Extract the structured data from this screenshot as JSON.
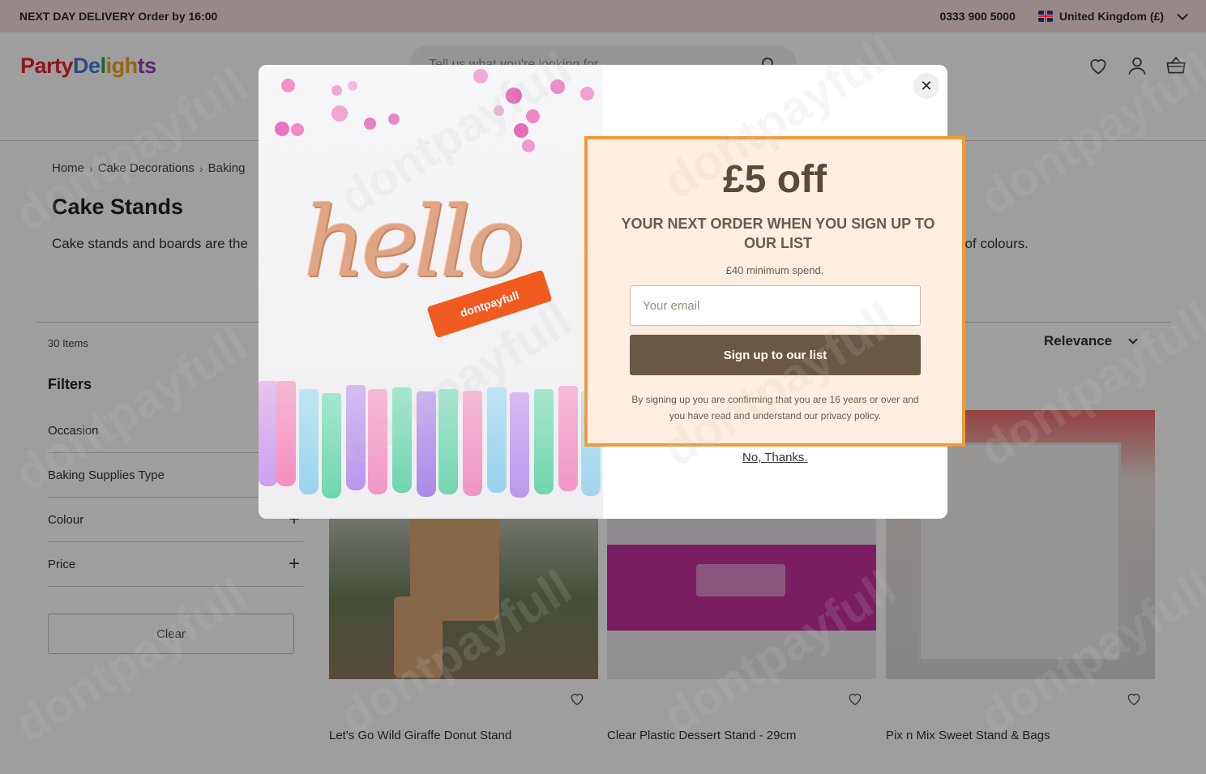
{
  "topbar": {
    "promo": "NEXT DAY DELIVERY Order by 16:00",
    "phone": "0333 900 5000",
    "region": "United Kingdom (£)"
  },
  "header": {
    "logo": {
      "part1": "Party",
      "part2": "De",
      "part3": "l",
      "part4": "igh",
      "part5": "ts"
    },
    "search_placeholder": "Tell us what you're looking for"
  },
  "breadcrumb": [
    "Home",
    "Cake Decorations",
    "Baking"
  ],
  "page": {
    "title": "Cake Stands",
    "description_left": "Cake stands and boards are the",
    "description_right": "ange of colours."
  },
  "listing": {
    "count": "30 Items",
    "sort_label": "Relevance",
    "filters_title": "Filters",
    "filters": [
      "Occasion",
      "Baking Supplies Type",
      "Colour",
      "Price"
    ],
    "clear_label": "Clear"
  },
  "products": [
    {
      "name": "Let's Go Wild Giraffe Donut Stand"
    },
    {
      "name": "Clear Plastic Dessert Stand - 29cm"
    },
    {
      "name": "Pix n Mix Sweet Stand & Bags"
    }
  ],
  "modal": {
    "image_text": "hello",
    "tag_text": "dontpayfull",
    "offer_title": "£5 off",
    "offer_subtitle": "YOUR NEXT ORDER WHEN YOU SIGN UP TO OUR LIST",
    "min_spend": "£40 minimum spend.",
    "email_placeholder": "Your email",
    "signup_label": "Sign up to our list",
    "legal_text": "By signing up you are confirming that you are 16 years or over and you have read and understand our privacy policy.",
    "no_thanks": "No, Thanks.",
    "close_symbol": "✕"
  },
  "watermark": "dontpayfull",
  "colors": {
    "topbar_bg": "#f5dede",
    "offer_border": "#f19a39",
    "offer_bg": "#fdeee1",
    "signup_button": "#6b5843"
  },
  "icons": [
    "uk-flag-icon",
    "chevron-down-icon",
    "search-icon",
    "heart-icon",
    "account-icon",
    "basket-icon",
    "plus-icon",
    "close-icon"
  ]
}
